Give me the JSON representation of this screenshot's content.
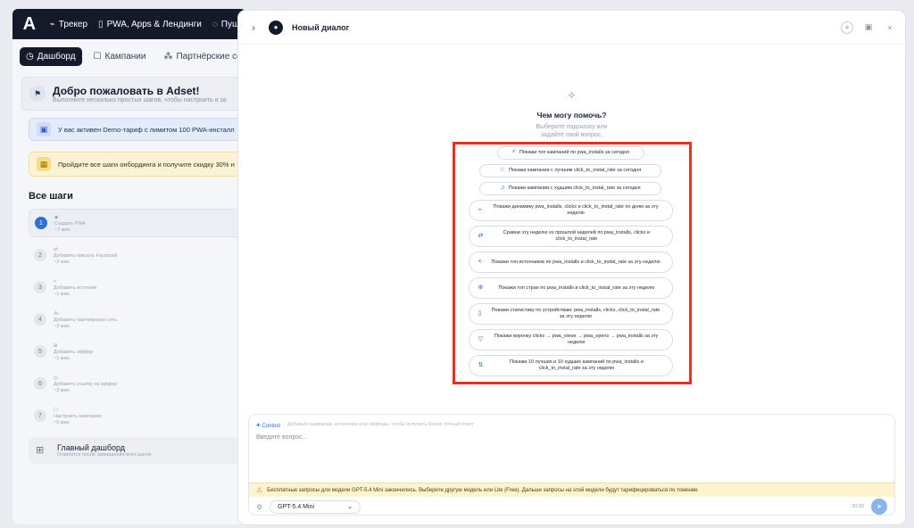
{
  "topbar": {
    "items": [
      {
        "icon": "chart-line-icon",
        "glyph": "⌁",
        "label": "Трекер"
      },
      {
        "icon": "mobile-icon",
        "glyph": "▯",
        "label": "PWA, Apps & Лендинги"
      },
      {
        "icon": "bell-icon",
        "glyph": "◌",
        "label": "Пуш"
      }
    ]
  },
  "subtabs": [
    {
      "icon": "dashboard-icon",
      "glyph": "◷",
      "label": "Дашборд"
    },
    {
      "icon": "campaign-icon",
      "glyph": "☐",
      "label": "Кампании"
    },
    {
      "icon": "network-icon",
      "glyph": "⁂",
      "label": "Партнёрские сети"
    }
  ],
  "welcome": {
    "title": "Добро пожаловать в Adset!",
    "subtitle": "Выполните несколько простых шагов, чтобы настроить и за"
  },
  "notices": {
    "demo": "У вас активен Demo-тариф с лимитом 100 PWA-инсталл",
    "onboarding": "Пройдите все шаги онбординга и получите скидку 30% н"
  },
  "steps": {
    "title": "Все шаги",
    "items": [
      {
        "num": "1",
        "icon": "◆",
        "label": "Создать PWA",
        "time": "~7 мин"
      },
      {
        "num": "2",
        "icon": "⇄",
        "label": "Добавить пиксель Facebook",
        "time": "~2 мин"
      },
      {
        "num": "3",
        "icon": "<",
        "label": "Добавить источник",
        "time": "~1 мин"
      },
      {
        "num": "4",
        "icon": "⁂",
        "label": "Добавить партнёрскую сеть",
        "time": "~3 мин"
      },
      {
        "num": "5",
        "icon": "⊞",
        "label": "Добавить оффер",
        "time": "~1 мин"
      },
      {
        "num": "6",
        "icon": "◎",
        "label": "Добавить ссылку на оффер",
        "time": "~3 мин"
      },
      {
        "num": "7",
        "icon": "☐",
        "label": "Настроить кампанию",
        "time": "~5 мин"
      }
    ]
  },
  "dashboard_lock": {
    "title": "Главный дашборд",
    "subtitle": "Откроется после завершения всех шагов"
  },
  "chat": {
    "title": "Новый диалог",
    "help_title": "Чем могу помочь?",
    "help_hint": "Выберите подсказку или задайте свой вопрос."
  },
  "suggestions": {
    "short": [
      {
        "icon": "⚡",
        "text": "Покажи топ кампаний по pwa_installs за сегодня"
      },
      {
        "icon": "☆",
        "text": "Покажи кампании с лучшим click_to_instal_rate за сегодня"
      },
      {
        "icon": "♫",
        "text": "Покажи кампании с худшим click_to_instal_rate за сегодня"
      }
    ],
    "long": [
      {
        "icon": "⌁",
        "text": "Покажи динамику pwa_installs, clicks и click_to_instal_rate по дням за эту неделю"
      },
      {
        "icon": "⇄",
        "text": "Сравни эту неделю vs прошлой неделей по pwa_installs, clicks и click_to_instal_rate"
      },
      {
        "icon": "<",
        "text": "Покажи топ источников по pwa_installs и click_to_instal_rate за эту неделю"
      },
      {
        "icon": "⊕",
        "text": "Покажи топ стран по pwa_installs и click_to_instal_rate за эту неделю"
      },
      {
        "icon": "▯",
        "text": "Покажи статистику по устройствам: pwa_installs, clicks, click_to_instal_rate за эту неделю"
      },
      {
        "icon": "▽",
        "text": "Покажи воронку clicks → pwa_views → pwa_opens → pwa_installs за эту неделю"
      },
      {
        "icon": "⇅",
        "text": "Покажи 10 лучших и 10 худших кампаний по pwa_installs и click_to_instal_rate за эту неделю"
      }
    ]
  },
  "composer": {
    "context_label": "Context",
    "context_hint": "Добавьте кампании, источники или офферы, чтобы получить более точный ответ",
    "placeholder": "Введите вопрос...",
    "warning": "Бесплатные запросы для модели GPT-5.4 Mini закончились. Выберите другую модель или Lite (Free). Дальше запросы на этой модели будут тарифицироваться по токенам.",
    "model": "GPT-5.4 Mini",
    "counter": "30/30"
  }
}
